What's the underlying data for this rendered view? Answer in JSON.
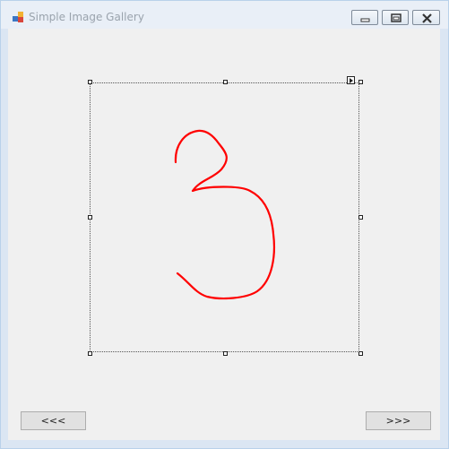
{
  "window": {
    "title": "Simple Image Gallery"
  },
  "buttons": {
    "prev_label": "<<<",
    "next_label": ">>>"
  },
  "image": {
    "content": "3",
    "stroke_color": "#ff0000"
  },
  "icons": {
    "app": "app-icon",
    "minimize": "minimize-icon",
    "maximize": "maximize-icon",
    "close": "close-icon",
    "smart_tag": "smart-tag-arrow-icon"
  },
  "colors": {
    "client_background": "#f0f0f0",
    "button_face": "#e1e1e1",
    "title_text": "#9aa3ad"
  }
}
